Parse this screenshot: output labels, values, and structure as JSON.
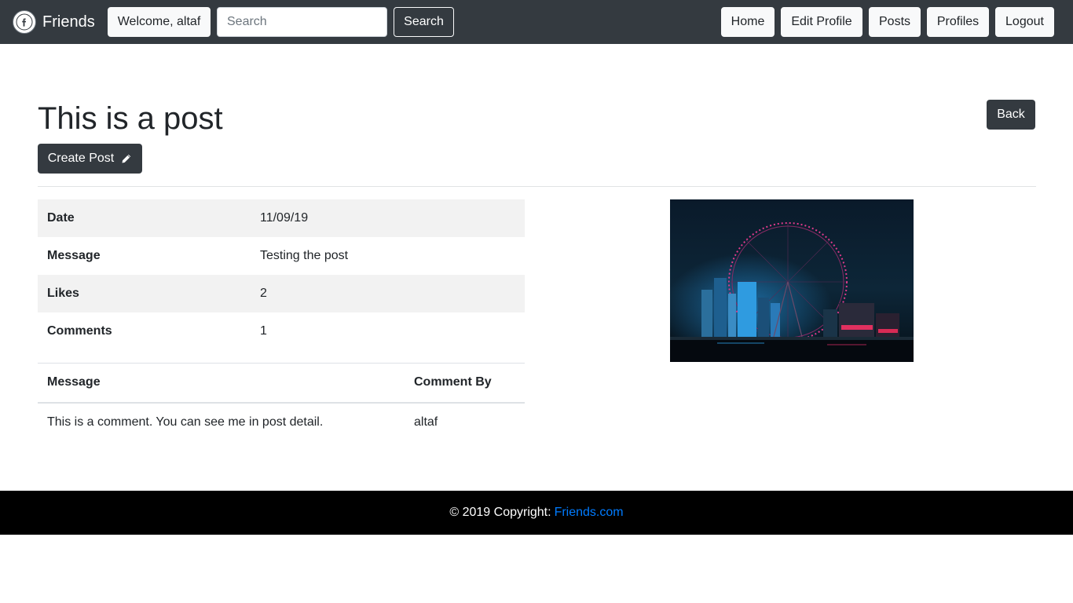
{
  "navbar": {
    "brand_icon": "facebook-logo-icon",
    "brand_name": "Friends",
    "welcome_label": "Welcome, altaf",
    "search_placeholder": "Search",
    "search_value": "",
    "search_button": "Search",
    "links": [
      "Home",
      "Edit Profile",
      "Posts",
      "Profiles",
      "Logout"
    ]
  },
  "page": {
    "title": "This is a post",
    "create_post_label": "Create Post",
    "create_post_icon": "pencil-icon",
    "back_label": "Back"
  },
  "details": [
    {
      "label": "Date",
      "value": "11/09/19"
    },
    {
      "label": "Message",
      "value": "Testing the post"
    },
    {
      "label": "Likes",
      "value": "2"
    },
    {
      "label": "Comments",
      "value": "1"
    }
  ],
  "comments": {
    "headers": [
      "Message",
      "Comment By"
    ],
    "rows": [
      {
        "message": "This is a comment. You can see me in post detail.",
        "by": "altaf"
      }
    ]
  },
  "image": {
    "icon": "ferris-wheel-night-photo"
  },
  "footer": {
    "text": "© 2019 Copyright:",
    "link": "Friends.com"
  },
  "colors": {
    "navbar": "#343a40",
    "footer": "#000000",
    "link": "#007bff",
    "dark_button": "#343a40",
    "stripe": "#f2f2f2"
  }
}
